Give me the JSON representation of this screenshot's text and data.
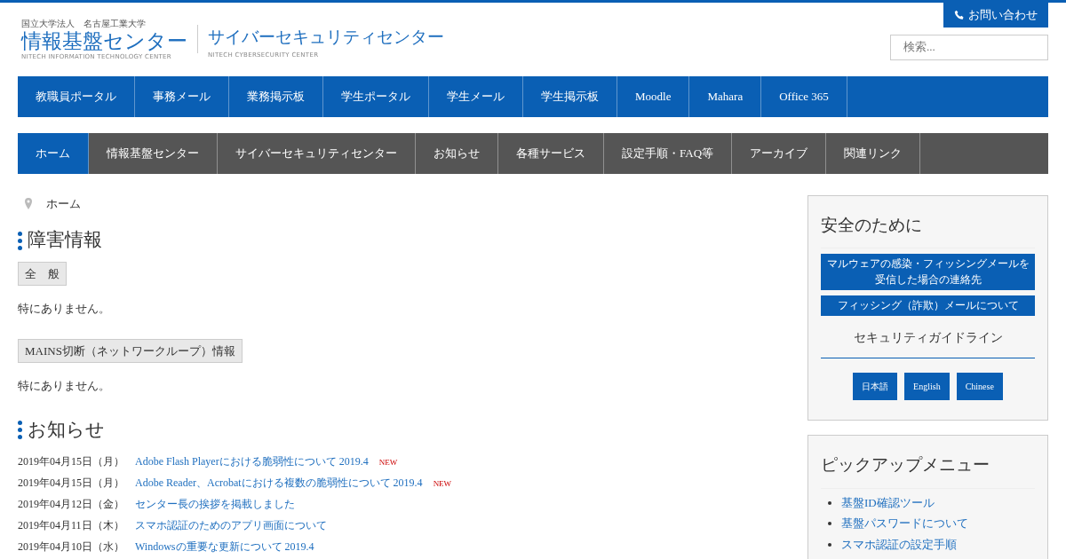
{
  "header": {
    "org_label": "国立大学法人　名古屋工業大学",
    "logo_title": "情報基盤センター",
    "logo_subtitle": "NITECH INFORMATION TECHNOLOGY CENTER",
    "second_title": "サイバーセキュリティセンター",
    "second_subtitle": "NITECH CYBERSECURITY CENTER",
    "contact_button": "お問い合わせ",
    "search": {
      "placeholder": "検索..."
    }
  },
  "service_nav": [
    "教職員ポータル",
    "事務メール",
    "業務掲示板",
    "学生ポータル",
    "学生メール",
    "学生掲示板",
    "Moodle",
    "Mahara",
    "Office 365"
  ],
  "main_nav": [
    {
      "label": "ホーム",
      "selected": true
    },
    {
      "label": "情報基盤センター",
      "selected": false
    },
    {
      "label": "サイバーセキュリティセンター",
      "selected": false
    },
    {
      "label": "お知らせ",
      "selected": false
    },
    {
      "label": "各種サービス",
      "selected": false
    },
    {
      "label": "設定手順・FAQ等",
      "selected": false
    },
    {
      "label": "アーカイブ",
      "selected": false
    },
    {
      "label": "関連リンク",
      "selected": false
    }
  ],
  "breadcrumb": [
    "ホーム"
  ],
  "outage": {
    "title": "障害情報",
    "groups": [
      {
        "label": "全　般",
        "text": "特にありません。"
      },
      {
        "label": "MAINS切断（ネットワークループ）情報",
        "text": "特にありません。"
      }
    ]
  },
  "news": {
    "title": "お知らせ",
    "items": [
      {
        "date": "2019年04月15日（月）",
        "title": "Adobe Flash Playerにおける脆弱性について 2019.4",
        "badge": "NEW"
      },
      {
        "date": "2019年04月15日（月）",
        "title": "Adobe Reader、Acrobatにおける複数の脆弱性について 2019.4",
        "badge": "NEW"
      },
      {
        "date": "2019年04月12日（金）",
        "title": "センター長の挨拶を掲載しました"
      },
      {
        "date": "2019年04月11日（木）",
        "title": "スマホ認証のためのアプリ画面について"
      },
      {
        "date": "2019年04月10日（水）",
        "title": "Windowsの重要な更新について 2019.4"
      }
    ]
  },
  "sidebar": {
    "safety": {
      "title": "安全のために",
      "links": [
        "マルウェアの感染・フィッシングメールを受信した場合の連絡先",
        "フィッシング（詐欺）メールについて"
      ],
      "guideline_title": "セキュリティガイドライン",
      "languages": [
        "日本語",
        "English",
        "Chinese"
      ]
    },
    "pickup": {
      "title": "ピックアップメニュー",
      "items": [
        "基盤ID確認ツール",
        "基盤パスワードについて",
        "スマホ認証の設定手順"
      ]
    }
  }
}
